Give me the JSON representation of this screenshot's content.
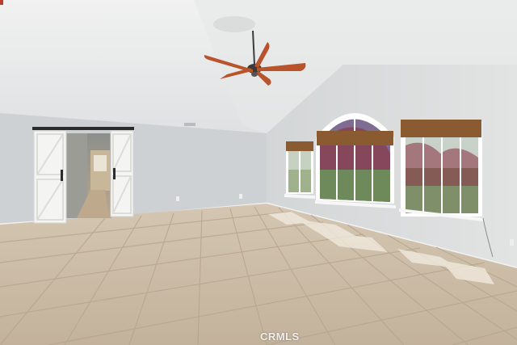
{
  "photo": {
    "subject": "empty-living-room",
    "watermark": "CRMLS"
  },
  "colors": {
    "ceiling": "#e9eaea",
    "wall_left": "#cfd3d5",
    "wall_right": "#dadcdc",
    "floor_tile": "#c9b9a3",
    "grout": "#b3a28c",
    "barn_door": "#f4f4f2",
    "rail": "#2b2b2b",
    "fan_blade": "#b8532c",
    "blind": "#8a5a30",
    "foliage": "#7a6a8e"
  }
}
